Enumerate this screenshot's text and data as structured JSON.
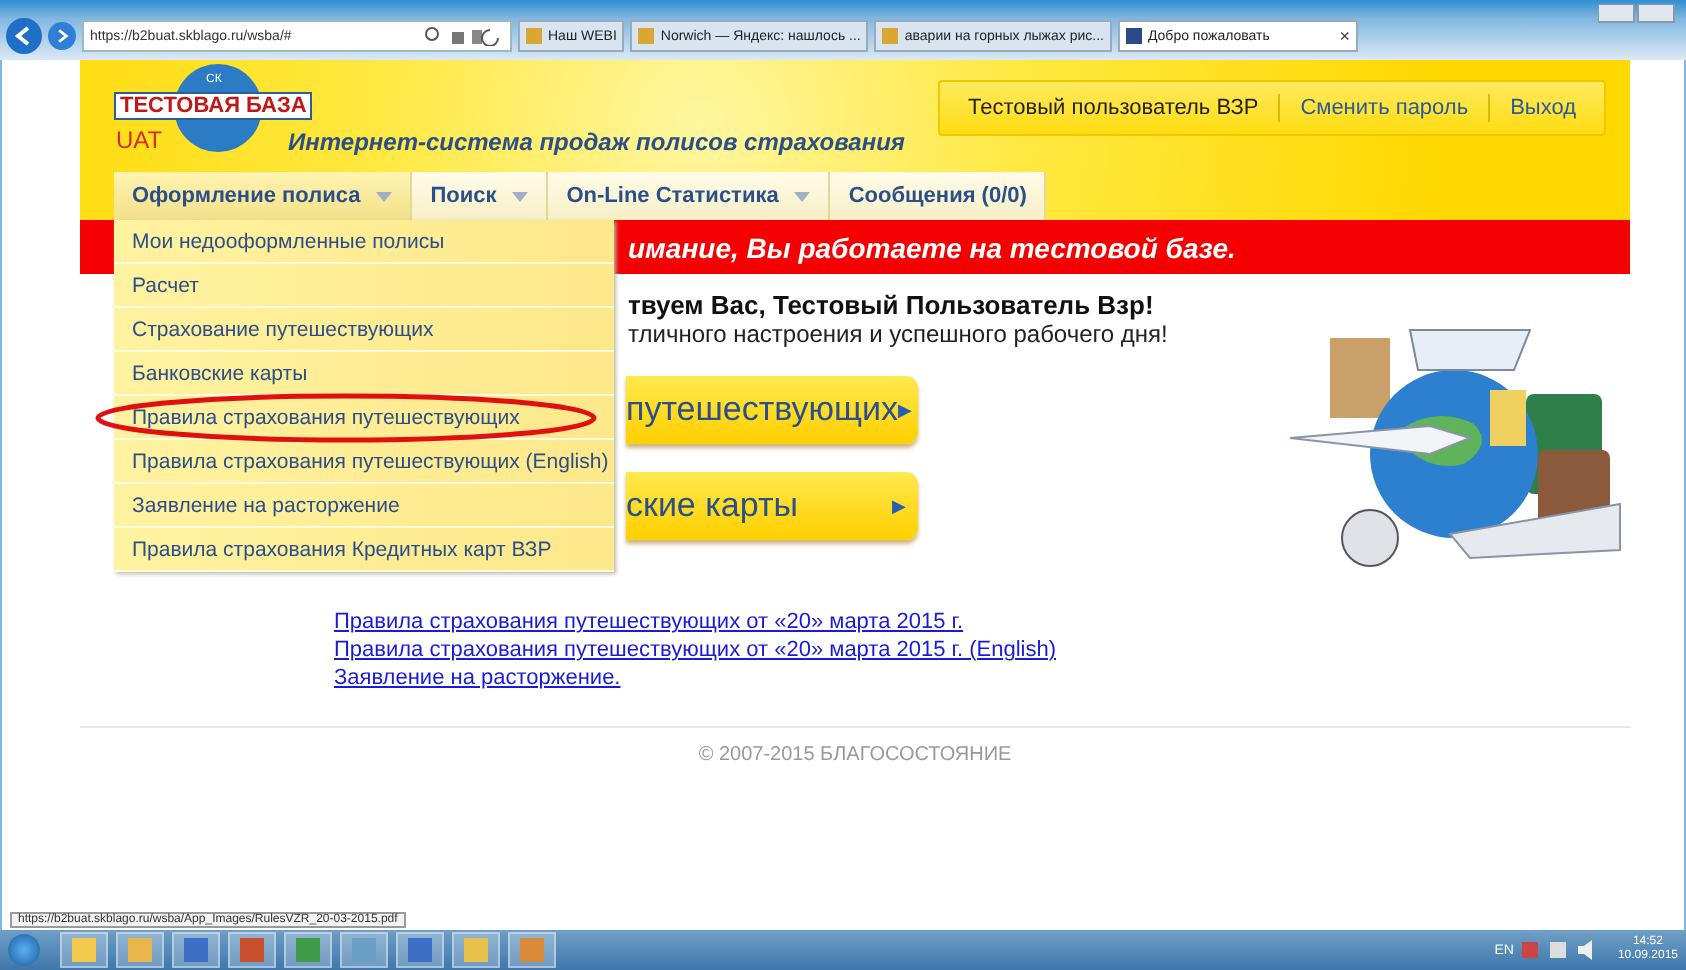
{
  "browser": {
    "address": "https://b2buat.skblago.ru/wsba/#",
    "tabs": [
      {
        "title": "Наш WEBI",
        "selected": false
      },
      {
        "title": "Norwich — Яндекс: нашлось ...",
        "selected": false
      },
      {
        "title": "аварии на горных лыжах рис...",
        "selected": false
      },
      {
        "title": "Добро пожаловать",
        "selected": true
      }
    ],
    "close": "×"
  },
  "header": {
    "logo_top": "СК",
    "logo_name": "ТЕСТОВАЯ БАЗА",
    "logo_badge": "UAT",
    "tagline": "Интернет-система продаж полисов страхования",
    "user": "Тестовый пользователь ВЗР",
    "user_links": [
      "Сменить пароль",
      "Выход"
    ]
  },
  "nav": [
    {
      "label": "Оформление полиса",
      "has_menu": true,
      "expanded": true
    },
    {
      "label": "Поиск",
      "has_menu": true,
      "expanded": false
    },
    {
      "label": "On-Line Статистика",
      "has_menu": true,
      "expanded": false
    },
    {
      "label": "Сообщения (0/0)",
      "has_menu": false,
      "expanded": false
    }
  ],
  "menu": [
    {
      "label": "Мои недооформленные полисы",
      "circled": false
    },
    {
      "label": "Расчет",
      "circled": false
    },
    {
      "label": "Страхование путешествующих",
      "circled": false
    },
    {
      "label": "Банковские карты",
      "circled": false
    },
    {
      "label": "Правила страхования путешествующих",
      "circled": true
    },
    {
      "label": "Правила страхования путешествующих (English)",
      "circled": false
    },
    {
      "label": "Заявление на расторжение",
      "circled": false
    },
    {
      "label": "Правила страхования Кредитных карт ВЗР",
      "circled": false
    }
  ],
  "banner": "имание, Вы работаете на тестовой базе.",
  "welcome": {
    "title": "твуем Вас, Тестовый Пользователь Взр!",
    "subtitle": "тличного настроения и успешного рабочего дня!"
  },
  "big_buttons": [
    {
      "label": "путешествующих",
      "arrow": "▶"
    },
    {
      "label": "ские карты",
      "arrow": "▶"
    }
  ],
  "links": [
    "Правила страхования путешествующих от «20» марта 2015 г.",
    "Правила страхования путешествующих от «20» марта 2015 г. (English)",
    "Заявление на расторжение."
  ],
  "footer": "© 2007-2015 БЛАГОСОСТОЯНИЕ",
  "status_url": "https://b2buat.skblago.ru/wsba/App_Images/RulesVZR_20-03-2015.pdf",
  "taskbar": {
    "language": "EN",
    "time": "14:52",
    "date": "10.09.2015"
  }
}
